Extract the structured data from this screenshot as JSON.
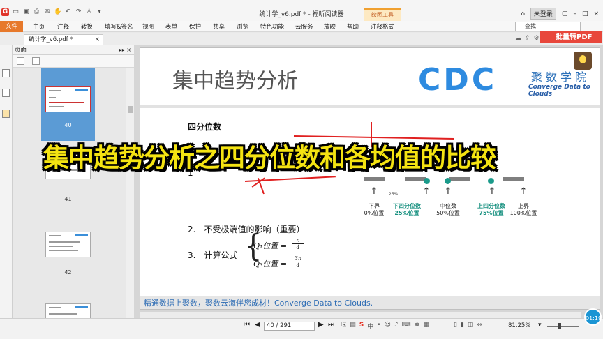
{
  "window": {
    "title": "统计学_v6.pdf * - 福昕阅读器",
    "context_tab": "绘图工具",
    "login_label": "未登录",
    "search_placeholder": "查找"
  },
  "menu": {
    "file": "文件",
    "items": [
      "主页",
      "注释",
      "转换",
      "填写&签名",
      "视图",
      "表单",
      "保护",
      "共享",
      "浏览",
      "特色功能",
      "云服务",
      "放映",
      "帮助",
      "注释格式"
    ]
  },
  "doc_tab": {
    "label": "统计学_v6.pdf *",
    "close": "×"
  },
  "batch_button": "批量转PDF",
  "panel": {
    "title": "页面",
    "controls": "▸▸ ×",
    "page_numbers": [
      "40",
      "41",
      "42"
    ]
  },
  "slide": {
    "title": "集中趋势分析",
    "logo_text": "CDC",
    "logo_cn": "聚数学院",
    "logo_en": "Converge Data to Clouds",
    "section": "四分位数",
    "item1_fragment": "1",
    "item2": "2.　不受极端值的影响（重要）",
    "item3_label": "3.　计算公式",
    "q1": "Q₁位置 = ",
    "q1_num": "n",
    "q1_den": "4",
    "q3": "Q₃位置 = ",
    "q3_num": "3n",
    "q3_den": "4",
    "pct25": "25%",
    "quartiles": [
      {
        "label": "下界",
        "sub": "0%位置",
        "teal": false
      },
      {
        "label": "下四分位数",
        "sub": "25%位置",
        "teal": true
      },
      {
        "label": "中位数",
        "sub": "50%位置",
        "teal": false
      },
      {
        "label": "上四分位数",
        "sub": "75%位置",
        "teal": true
      },
      {
        "label": "上界",
        "sub": "100%位置",
        "teal": false
      }
    ],
    "footer": "精通数据上聚数，聚数云海伴您成材！Converge Data to Clouds."
  },
  "caption": "集中趋势分析之四分位数和各均值的比较",
  "timer": "01:19",
  "status": {
    "page_indicator": "40 / 291",
    "zoom": "81.25%"
  }
}
